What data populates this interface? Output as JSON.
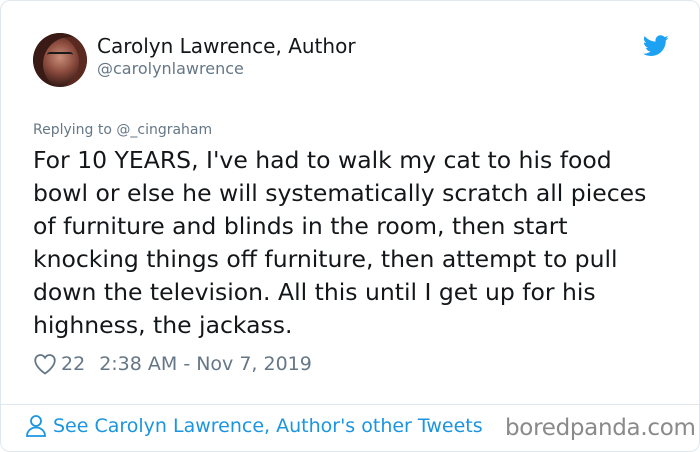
{
  "author": {
    "display_name": "Carolyn Lawrence, Author",
    "handle": "@carolynlawrence"
  },
  "reply": {
    "text": "Replying to @_cingraham"
  },
  "tweet": {
    "body": "For 10 YEARS, I've had to walk my cat to his food bowl or else he will systematically scratch all pieces of furniture and blinds in the room, then start knocking things off furniture, then attempt to pull down the television. All this until I get up for his highness, the jackass.",
    "likes": "22",
    "timestamp": "2:38 AM - Nov 7, 2019"
  },
  "footer": {
    "link_text": "See Carolyn Lawrence, Author's other Tweets"
  },
  "watermark": {
    "text": "boredpanda.com"
  },
  "colors": {
    "twitter_blue": "#1da1f2",
    "link_blue": "#1b95e0",
    "secondary_text": "#657786"
  },
  "icons": {
    "brand": "twitter-bird-icon",
    "like": "heart-icon",
    "profile": "person-icon"
  }
}
